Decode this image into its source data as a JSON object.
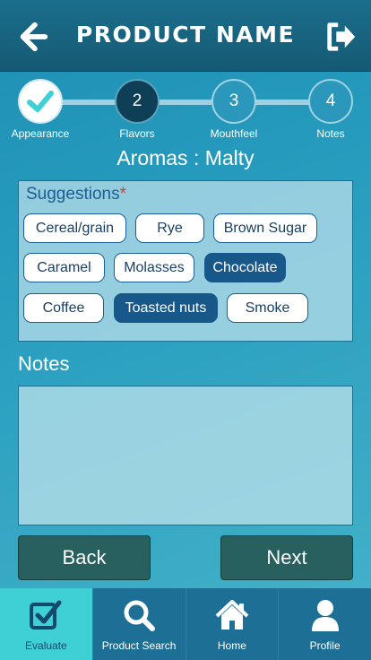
{
  "header": {
    "title": "PRODUCT NAME",
    "back_icon": "back-arrow-icon",
    "logout_icon": "logout-icon"
  },
  "stepper": {
    "steps": [
      {
        "number": "",
        "label": "Appearance",
        "state": "done"
      },
      {
        "number": "2",
        "label": "Flavors",
        "state": "active"
      },
      {
        "number": "3",
        "label": "Mouthfeel",
        "state": "todo"
      },
      {
        "number": "4",
        "label": "Notes",
        "state": "todo"
      }
    ]
  },
  "aroma": {
    "title": "Aromas : Malty"
  },
  "suggestions": {
    "title": "Suggestions",
    "required_mark": "*",
    "chips": [
      {
        "label": "Cereal/grain",
        "selected": false
      },
      {
        "label": "Rye",
        "selected": false
      },
      {
        "label": "Brown Sugar",
        "selected": false
      },
      {
        "label": "Caramel",
        "selected": false
      },
      {
        "label": "Molasses",
        "selected": false
      },
      {
        "label": "Chocolate",
        "selected": true
      },
      {
        "label": "Coffee",
        "selected": false
      },
      {
        "label": "Toasted nuts",
        "selected": true
      },
      {
        "label": "Smoke",
        "selected": false
      }
    ]
  },
  "notes": {
    "label": "Notes",
    "value": "",
    "placeholder": ""
  },
  "buttons": {
    "back": "Back",
    "next": "Next"
  },
  "tabbar": {
    "tabs": [
      {
        "label": "Evaluate",
        "icon": "evaluate-checkbox-icon",
        "active": true
      },
      {
        "label": "Product Search",
        "icon": "search-icon",
        "active": false
      },
      {
        "label": "Home",
        "icon": "home-icon",
        "active": false
      },
      {
        "label": "Profile",
        "icon": "profile-icon",
        "active": false
      }
    ]
  },
  "colors": {
    "header_bg": "#155a74",
    "selected_chip": "#17578a",
    "required": "#e0362c",
    "button_bg": "#27605e",
    "active_tab": "#3fd0d6"
  }
}
